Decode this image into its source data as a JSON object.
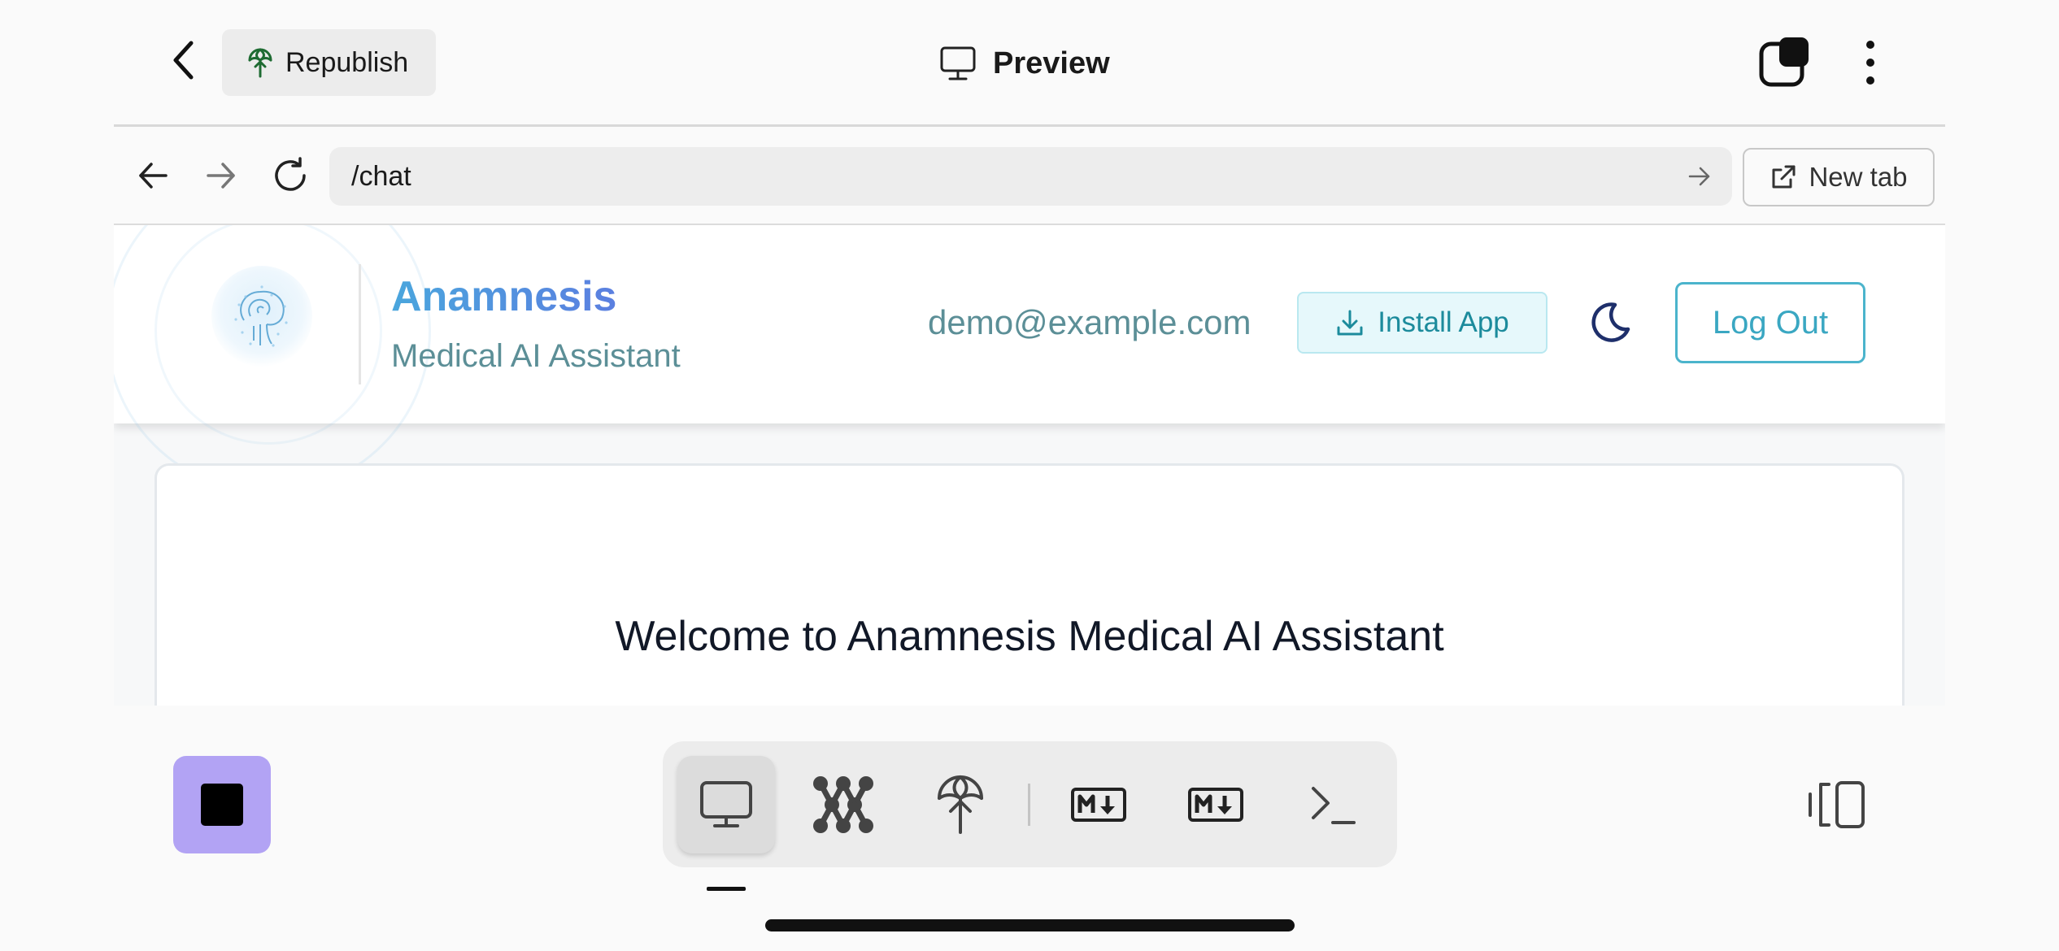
{
  "topbar": {
    "republish_label": "Republish",
    "title": "Preview"
  },
  "browser": {
    "url": "/chat",
    "new_tab_label": "New tab"
  },
  "site": {
    "brand_name": "Anamnesis",
    "brand_subtitle": "Medical AI Assistant",
    "user_email": "demo@example.com",
    "install_label": "Install App",
    "logout_label": "Log Out",
    "welcome_title": "Welcome to Anamnesis Medical AI Assistant"
  },
  "dock": {
    "tools": [
      {
        "icon": "monitor-icon",
        "active": true
      },
      {
        "icon": "nodes-icon",
        "active": false
      },
      {
        "icon": "publish-icon",
        "active": false
      },
      {
        "icon": "markdown-download-icon",
        "active": false
      },
      {
        "icon": "markdown-download-icon",
        "active": false
      },
      {
        "icon": "terminal-icon",
        "active": false
      }
    ]
  },
  "colors": {
    "stop_button": "#b2a3f4",
    "brand_gradient_start": "#4aa6dd",
    "brand_gradient_end": "#5b7fe0",
    "teal_text": "#5c8f97",
    "logout_border": "#4bb4cc",
    "install_bg": "#e6f8fb"
  }
}
